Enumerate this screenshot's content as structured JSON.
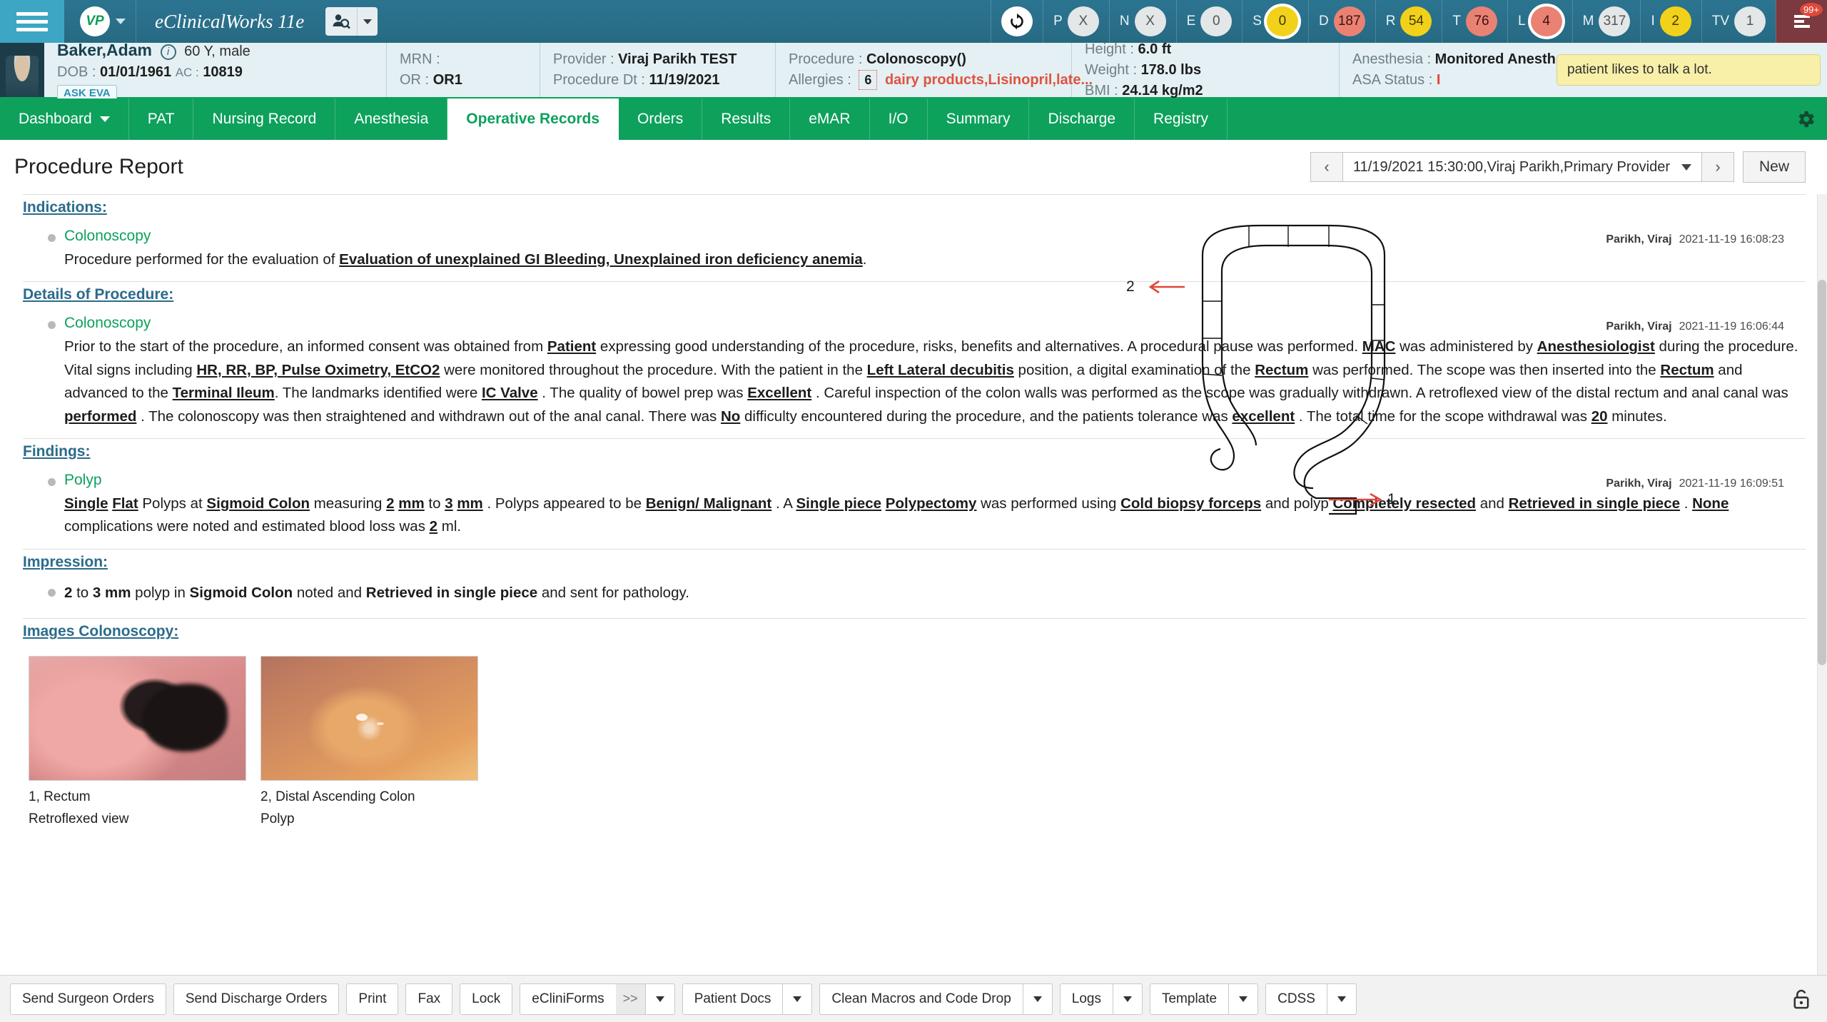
{
  "topbar": {
    "menu_icon": "hamburger-icon",
    "user_initials": "VP",
    "brand": "eClinicalWorks 11e",
    "patient_search_icon": "patient-search-icon",
    "refresh_icon": "refresh-icon",
    "notification_badge": "99+",
    "counters": [
      {
        "key": "P",
        "value": "X",
        "style": "grey",
        "ring": false
      },
      {
        "key": "N",
        "value": "X",
        "style": "grey",
        "ring": false
      },
      {
        "key": "E",
        "value": "0",
        "style": "grey",
        "ring": false
      },
      {
        "key": "S",
        "value": "0",
        "style": "yellow",
        "ring": true
      },
      {
        "key": "D",
        "value": "187",
        "style": "red",
        "ring": false
      },
      {
        "key": "R",
        "value": "54",
        "style": "yellow",
        "ring": false
      },
      {
        "key": "T",
        "value": "76",
        "style": "red",
        "ring": false
      },
      {
        "key": "L",
        "value": "4",
        "style": "red",
        "ring": true
      },
      {
        "key": "M",
        "value": "317",
        "style": "grey",
        "ring": false
      },
      {
        "key": "I",
        "value": "2",
        "style": "yellow",
        "ring": false
      },
      {
        "key": "TV",
        "value": "1",
        "style": "grey",
        "ring": false
      }
    ]
  },
  "patient": {
    "name": "Baker,Adam",
    "age_sex": "60 Y, male",
    "dob_label": "DOB :",
    "dob": "01/01/1961",
    "ac_label": "AC :",
    "ac": "10819",
    "ask_eva": "ASK EVA",
    "mrn_label": "MRN :",
    "mrn": "",
    "or_label": "OR :",
    "or": "OR1",
    "provider_label": "Provider :",
    "provider": "Viraj Parikh TEST",
    "procedure_dt_label": "Procedure Dt :",
    "procedure_dt": "11/19/2021",
    "procedure_label": "Procedure :",
    "procedure": "Colonoscopy()",
    "allergies_label": "Allergies :",
    "allergies_count": "6",
    "allergies": "dairy products,Lisinopril,late...",
    "height_label": "Height :",
    "height": "6.0 ft",
    "weight_label": "Weight :",
    "weight": "178.0 lbs",
    "bmi_label": "BMI :",
    "bmi": "24.14 kg/m2",
    "anesthesia_label": "Anesthesia :",
    "anesthesia": "Monitored Anesth...",
    "asa_label": "ASA Status :",
    "asa": "I",
    "note": "patient likes to talk a lot."
  },
  "nav": {
    "items": [
      {
        "label": "Dashboard",
        "caret": true,
        "active": false
      },
      {
        "label": "PAT",
        "caret": false,
        "active": false
      },
      {
        "label": "Nursing Record",
        "caret": false,
        "active": false
      },
      {
        "label": "Anesthesia",
        "caret": false,
        "active": false
      },
      {
        "label": "Operative Records",
        "caret": false,
        "active": true
      },
      {
        "label": "Orders",
        "caret": false,
        "active": false
      },
      {
        "label": "Results",
        "caret": false,
        "active": false
      },
      {
        "label": "eMAR",
        "caret": false,
        "active": false
      },
      {
        "label": "I/O",
        "caret": false,
        "active": false
      },
      {
        "label": "Summary",
        "caret": false,
        "active": false
      },
      {
        "label": "Discharge",
        "caret": false,
        "active": false
      },
      {
        "label": "Registry",
        "caret": false,
        "active": false
      }
    ],
    "settings_icon": "gear-icon"
  },
  "page": {
    "title": "Procedure Report",
    "prev_icon": "chevron-left-icon",
    "next_icon": "chevron-right-icon",
    "visit_selected": "11/19/2021 15:30:00,Viraj Parikh,Primary Provider",
    "new_button": "New"
  },
  "report": {
    "indications": {
      "heading": "Indications:",
      "sub": "Colonoscopy",
      "author": "Parikh, Viraj",
      "timestamp": "2021-11-19 16:08:23",
      "text_pre": "Procedure performed for the evaluation of ",
      "text_bold": "Evaluation of unexplained GI Bleeding, Unexplained iron deficiency anemia",
      "text_post": "."
    },
    "details": {
      "heading": "Details of Procedure:",
      "sub": "Colonoscopy",
      "author": "Parikh, Viraj",
      "timestamp": "2021-11-19 16:06:44",
      "segments": [
        {
          "t": "Prior to the start of the procedure, an informed consent was obtained from ",
          "b": false
        },
        {
          "t": "Patient",
          "b": true
        },
        {
          "t": " expressing good understanding of the procedure, risks, benefits and alternatives. A procedural pause was performed. ",
          "b": false
        },
        {
          "t": "MAC",
          "b": true
        },
        {
          "t": " was administered by ",
          "b": false
        },
        {
          "t": "Anesthesiologist",
          "b": true
        },
        {
          "t": " during the procedure. Vital signs including ",
          "b": false
        },
        {
          "t": "HR, RR, BP, Pulse Oximetry, EtCO2",
          "b": true
        },
        {
          "t": " were monitored throughout the procedure. With the patient in the ",
          "b": false
        },
        {
          "t": "Left Lateral decubitis",
          "b": true
        },
        {
          "t": " position, a digital examination of the ",
          "b": false
        },
        {
          "t": "Rectum",
          "b": true
        },
        {
          "t": " was performed. The scope was then inserted into the ",
          "b": false
        },
        {
          "t": "Rectum",
          "b": true
        },
        {
          "t": " and advanced to the ",
          "b": false
        },
        {
          "t": "Terminal Ileum",
          "b": true
        },
        {
          "t": ". The landmarks identified were ",
          "b": false
        },
        {
          "t": "IC Valve",
          "b": true
        },
        {
          "t": " . The quality of bowel prep was ",
          "b": false
        },
        {
          "t": "Excellent",
          "b": true
        },
        {
          "t": " . Careful inspection of the colon walls was performed as the scope was gradually withdrawn. A retroflexed view of the distal rectum and anal canal was ",
          "b": false
        },
        {
          "t": "performed",
          "b": true
        },
        {
          "t": " . The colonoscopy was then straightened and withdrawn out of the anal canal. There was ",
          "b": false
        },
        {
          "t": "No",
          "b": true
        },
        {
          "t": " difficulty encountered during the procedure, and the patients tolerance was ",
          "b": false
        },
        {
          "t": "excellent",
          "b": true
        },
        {
          "t": " . The total time for the scope withdrawal was ",
          "b": false
        },
        {
          "t": "20",
          "b": true
        },
        {
          "t": " minutes.",
          "b": false
        }
      ]
    },
    "findings": {
      "heading": "Findings:",
      "sub": "Polyp",
      "author": "Parikh, Viraj",
      "timestamp": "2021-11-19 16:09:51",
      "segments": [
        {
          "t": "Single",
          "b": true
        },
        {
          "t": " ",
          "b": false
        },
        {
          "t": "Flat",
          "b": true
        },
        {
          "t": " Polyps at ",
          "b": false
        },
        {
          "t": "Sigmoid Colon",
          "b": true
        },
        {
          "t": " measuring ",
          "b": false
        },
        {
          "t": "2",
          "b": true
        },
        {
          "t": " ",
          "b": false
        },
        {
          "t": "mm",
          "b": true
        },
        {
          "t": " to ",
          "b": false
        },
        {
          "t": "3",
          "b": true
        },
        {
          "t": " ",
          "b": false
        },
        {
          "t": "mm",
          "b": true
        },
        {
          "t": " . Polyps appeared to be ",
          "b": false
        },
        {
          "t": "Benign/ Malignant",
          "b": true
        },
        {
          "t": " . A ",
          "b": false
        },
        {
          "t": "Single piece",
          "b": true
        },
        {
          "t": " ",
          "b": false
        },
        {
          "t": "Polypectomy",
          "b": true
        },
        {
          "t": " was performed using ",
          "b": false
        },
        {
          "t": "Cold biopsy forceps",
          "b": true
        },
        {
          "t": " and polyp ",
          "b": false
        },
        {
          "t": "Completely resected",
          "b": true
        },
        {
          "t": " and ",
          "b": false
        },
        {
          "t": "Retrieved in single piece",
          "b": true
        },
        {
          "t": " . ",
          "b": false
        },
        {
          "t": "None",
          "b": true
        },
        {
          "t": " complications were noted and estimated blood loss was ",
          "b": false
        },
        {
          "t": "2",
          "b": true
        },
        {
          "t": " ml.",
          "b": false
        }
      ]
    },
    "impression": {
      "heading": "Impression:",
      "segments": [
        {
          "t": "2",
          "b": true
        },
        {
          "t": " to ",
          "b": false
        },
        {
          "t": "3",
          "b": true
        },
        {
          "t": " ",
          "b": false
        },
        {
          "t": "mm",
          "b": true
        },
        {
          "t": " polyp in ",
          "b": false
        },
        {
          "t": "Sigmoid Colon",
          "b": true
        },
        {
          "t": " noted and ",
          "b": false
        },
        {
          "t": "Retrieved in single piece",
          "b": true
        },
        {
          "t": " and sent for pathology.",
          "b": false
        }
      ]
    },
    "images": {
      "heading": "Images Colonoscopy:",
      "items": [
        {
          "caption": "1, Rectum",
          "subcaption": "Retroflexed view"
        },
        {
          "caption": "2, Distal Ascending Colon",
          "subcaption": "Polyp"
        }
      ],
      "diagram_markers": [
        "2",
        "1"
      ]
    }
  },
  "toolbar": {
    "buttons": [
      {
        "label": "Send Surgeon Orders",
        "chev": false,
        "arrows": false
      },
      {
        "label": "Send Discharge Orders",
        "chev": false,
        "arrows": false
      },
      {
        "label": "Print",
        "chev": false,
        "arrows": false
      },
      {
        "label": "Fax",
        "chev": false,
        "arrows": false
      },
      {
        "label": "Lock",
        "chev": false,
        "arrows": false
      },
      {
        "label": "eCliniForms",
        "chev": true,
        "arrows": true,
        "arrows_label": ">>"
      },
      {
        "label": "Patient Docs",
        "chev": true,
        "arrows": false
      },
      {
        "label": "Clean Macros and Code Drop",
        "chev": true,
        "arrows": false
      },
      {
        "label": "Logs",
        "chev": true,
        "arrows": false
      },
      {
        "label": "Template",
        "chev": true,
        "arrows": false
      },
      {
        "label": "CDSS",
        "chev": true,
        "arrows": false
      }
    ],
    "lock_icon": "lock-icon"
  },
  "colors": {
    "teal": "#2a6f8a",
    "green": "#0da15c",
    "banner": "#e4f0f4",
    "section_heading": "#2b6b8c",
    "allergy_red": "#e0533f",
    "note_yellow": "#f8f0a8"
  }
}
